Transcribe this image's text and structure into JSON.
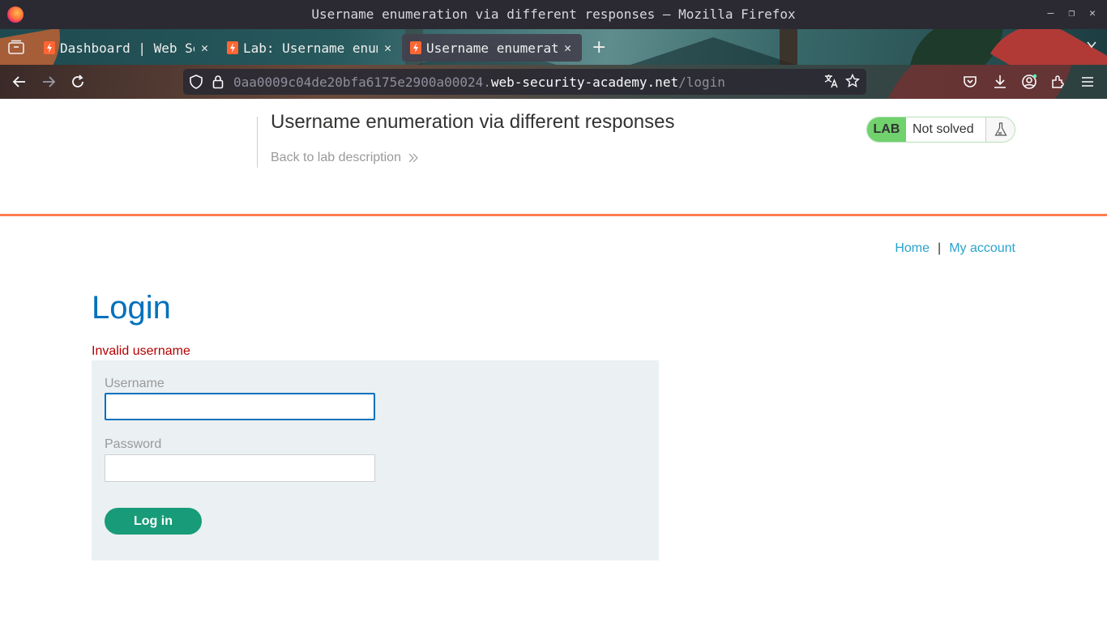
{
  "window": {
    "title": "Username enumeration via different responses — Mozilla Firefox"
  },
  "tabs": [
    {
      "label": "Dashboard | Web Security Academy",
      "active": false
    },
    {
      "label": "Lab: Username enumeration via different responses",
      "active": false
    },
    {
      "label": "Username enumeration via different responses",
      "active": true
    }
  ],
  "urlbar": {
    "prefix": "0aa0009c04de20bfa6175e2900a00024.",
    "domain": "web-security-academy.net",
    "path": "/login"
  },
  "lab": {
    "title": "Username enumeration via different responses",
    "back_link": "Back to lab description",
    "badge": "LAB",
    "status": "Not solved"
  },
  "nav": {
    "home": "Home",
    "separator": "|",
    "account": "My account"
  },
  "login": {
    "heading": "Login",
    "error": "Invalid username",
    "username_label": "Username",
    "username_value": "",
    "password_label": "Password",
    "password_value": "",
    "submit": "Log in"
  },
  "colors": {
    "heading_blue": "#0071bc",
    "link_blue": "#29a3cc",
    "error_red": "#b50000",
    "button_green": "#189b78",
    "lab_green": "#70d16d",
    "accent_orange": "#ff6633"
  }
}
